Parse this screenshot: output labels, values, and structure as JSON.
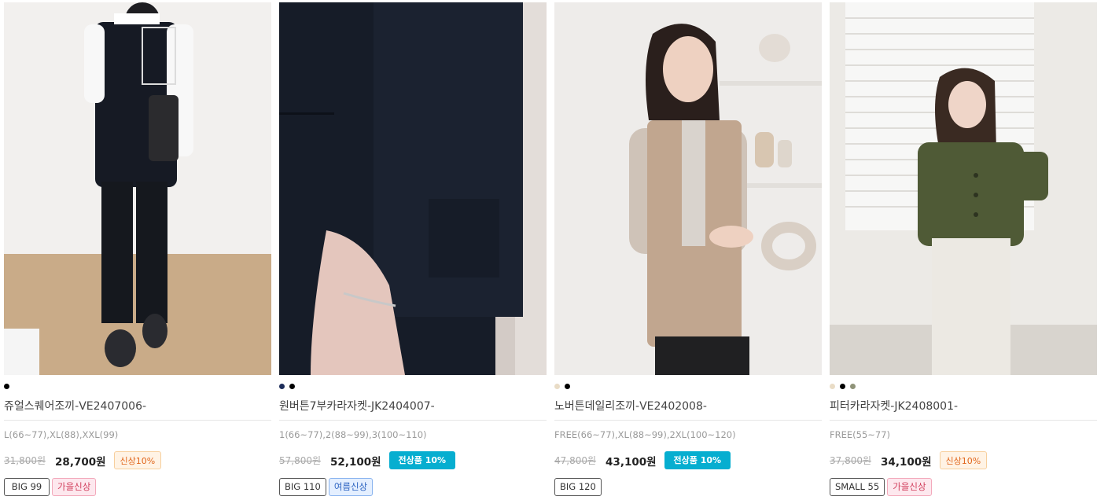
{
  "products": [
    {
      "name": "쥬얼스퀘어조끼-VE2407006-",
      "colors": [
        "#000000"
      ],
      "sizes": "L(66~77),XL(88),XXL(99)",
      "old_price": "31,800원",
      "price": "28,700원",
      "promo": "신상10%",
      "tags": [
        "BIG 99",
        "가을신상"
      ]
    },
    {
      "name": "원버튼7부카라자켓-JK2404007-",
      "colors": [
        "#1d2d5a",
        "#000000"
      ],
      "sizes": "1(66~77),2(88~99),3(100~110)",
      "old_price": "57,800원",
      "price": "52,100원",
      "promo": "전상품 10%",
      "tags": [
        "BIG 110",
        "여름신상"
      ]
    },
    {
      "name": "노버튼데일리조끼-VE2402008-",
      "colors": [
        "#e9dcc6",
        "#000000"
      ],
      "sizes": "FREE(66~77),XL(88~99),2XL(100~120)",
      "old_price": "47,800원",
      "price": "43,100원",
      "promo": "전상품 10%",
      "tags": [
        "BIG 120"
      ]
    },
    {
      "name": "피터카라자켓-JK2408001-",
      "colors": [
        "#e9dcc6",
        "#000000",
        "#8f9378"
      ],
      "sizes": "FREE(55~77)",
      "old_price": "37,800원",
      "price": "34,100원",
      "promo": "신상10%",
      "tags": [
        "SMALL 55",
        "가을신상"
      ]
    }
  ]
}
